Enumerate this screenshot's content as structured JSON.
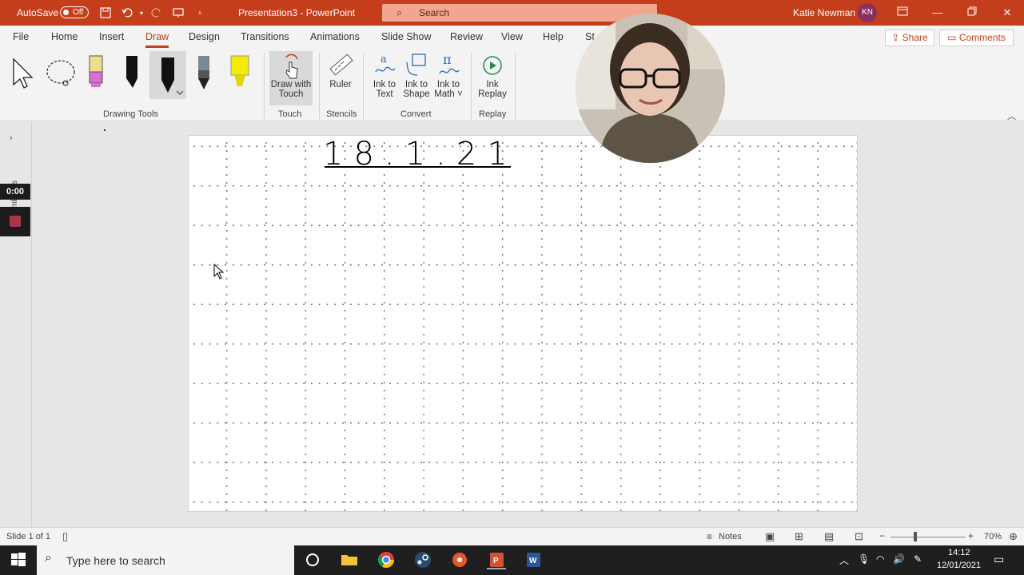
{
  "titlebar": {
    "autosave_label": "AutoSave",
    "autosave_state": "Off",
    "document_title": "Presentation3  -  PowerPoint",
    "search_placeholder": "Search",
    "user_name": "Katie Newman",
    "user_initials": "KN"
  },
  "tabs": [
    "File",
    "Home",
    "Insert",
    "Draw",
    "Design",
    "Transitions",
    "Animations",
    "Slide Show",
    "Review",
    "View",
    "Help",
    "St"
  ],
  "active_tab": "Draw",
  "share_label": "Share",
  "comments_label": "Comments",
  "ribbon": {
    "groups": {
      "drawing_tools": "Drawing Tools",
      "touch": "Touch",
      "stencils": "Stencils",
      "convert": "Convert",
      "replay": "Replay"
    },
    "buttons": {
      "draw_with_touch": [
        "Draw with",
        "Touch"
      ],
      "ruler": "Ruler",
      "ink_to_text": [
        "Ink to",
        "Text"
      ],
      "ink_to_shape": [
        "Ink to",
        "Shape"
      ],
      "ink_to_math": [
        "Ink to",
        "Math ˅"
      ],
      "ink_replay": [
        "Ink",
        "Replay"
      ]
    }
  },
  "left_pane": {
    "thumbnails_label": "mbnails",
    "timer": "0:00"
  },
  "slide": {
    "handwriting": "18.1.21"
  },
  "statusbar": {
    "slide_counter": "Slide 1 of 1",
    "notes_label": "Notes",
    "zoom": "70%"
  },
  "taskbar": {
    "search_placeholder": "Type here to search",
    "time": "14:12",
    "date": "12/01/2021"
  },
  "colors": {
    "accent": "#c43e1c",
    "taskbar": "#1f1f1f"
  }
}
